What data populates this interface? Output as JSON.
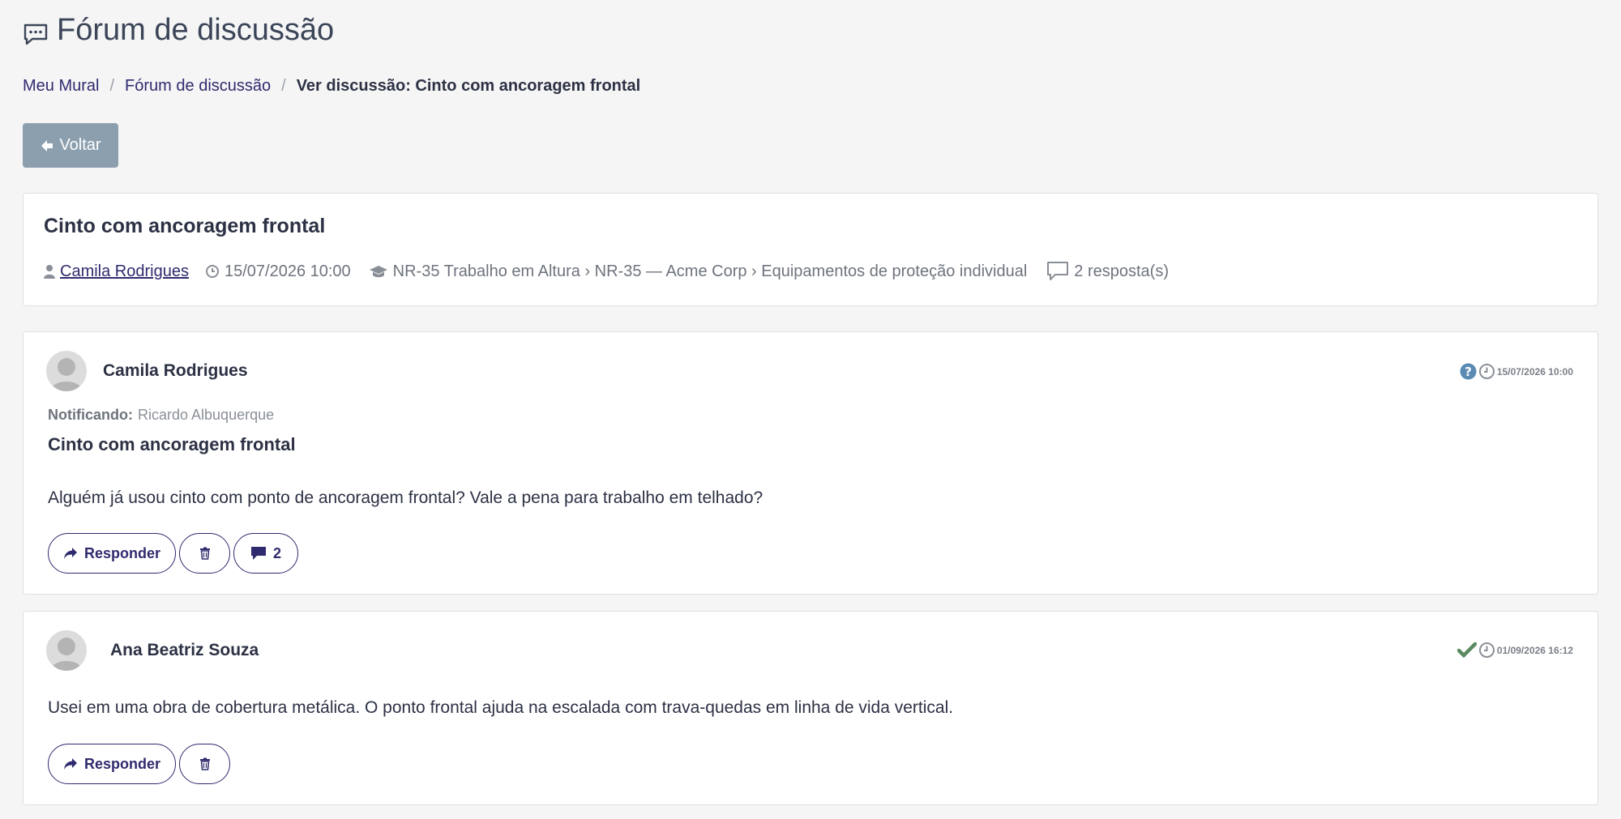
{
  "page": {
    "title": "Fórum de discussão"
  },
  "breadcrumb": {
    "items": [
      "Meu Mural",
      "Fórum de discussão"
    ],
    "current": "Ver discussão: Cinto com ancoragem frontal",
    "separator": "/"
  },
  "back_button": {
    "label": "Voltar"
  },
  "summary": {
    "title": "Cinto com ancoragem frontal",
    "author": "Camila Rodrigues",
    "datetime": "15/07/2026 10:00",
    "course_path": "NR-35 Trabalho em Altura › NR-35 — Acme Corp › Equipamentos de proteção individual",
    "replies": "2 resposta(s)"
  },
  "posts": [
    {
      "author": "Camila Rodrigues",
      "datetime": "15/07/2026 10:00",
      "status_icon": "question-icon",
      "notify_label": "Notificando:",
      "notify_name": "Ricardo Albuquerque",
      "subject": "Cinto com ancoragem frontal",
      "body": "Alguém já usou cinto com ponto de ancoragem frontal? Vale a pena para trabalho em telhado?",
      "reply_label": "Responder",
      "reply_count": "2"
    },
    {
      "author": "Ana Beatriz Souza",
      "datetime": "01/09/2026 16:12",
      "status_icon": "check-icon",
      "body": "Usei em uma obra de cobertura metálica. O ponto frontal ajuda na escalada com trava-quedas em linha de vida vertical.",
      "reply_label": "Responder"
    }
  ],
  "colors": {
    "link": "#2f2b6e",
    "back_button": "#8c9fae",
    "question": "#5b8bb3",
    "check": "#5a8a60",
    "background": "#f5f5f6"
  }
}
